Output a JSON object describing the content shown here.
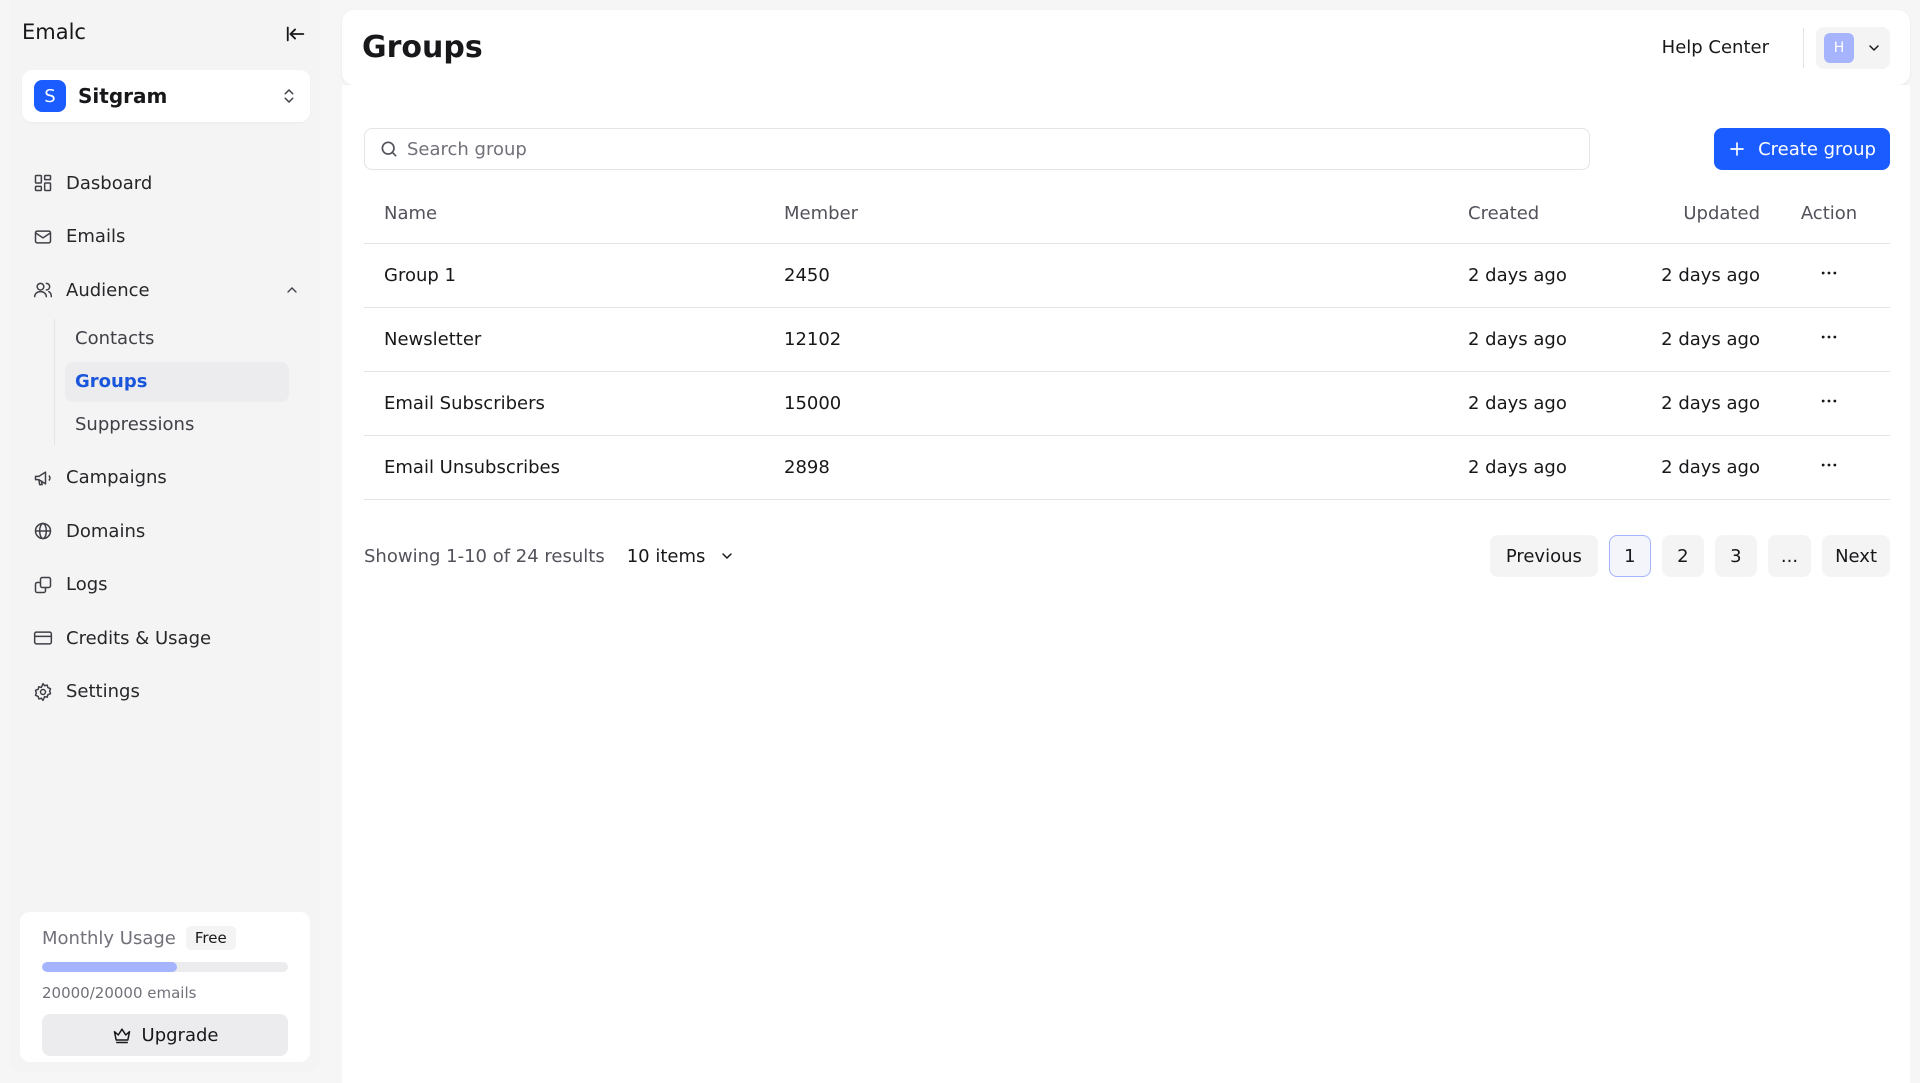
{
  "app": {
    "brand": "Emalc"
  },
  "workspace": {
    "initial": "S",
    "name": "Sitgram"
  },
  "nav": {
    "dashboard": "Dasboard",
    "emails": "Emails",
    "audience": "Audience",
    "audience_sub": [
      "Contacts",
      "Groups",
      "Suppressions"
    ],
    "campaigns": "Campaigns",
    "domains": "Domains",
    "logs": "Logs",
    "credits": "Credits & Usage",
    "settings": "Settings"
  },
  "usage": {
    "title": "Monthly Usage",
    "plan": "Free",
    "count_text": "20000/20000 emails",
    "progress_percent": 55,
    "upgrade_label": "Upgrade"
  },
  "header": {
    "title": "Groups",
    "help_label": "Help Center",
    "user_initial": "H"
  },
  "search": {
    "placeholder": "Search group",
    "value": ""
  },
  "create_label": "Create group",
  "table": {
    "columns": [
      "Name",
      "Member",
      "Created",
      "Updated",
      "Action"
    ],
    "rows": [
      {
        "name": "Group 1",
        "member": "2450",
        "created": "2 days ago",
        "updated": "2 days ago"
      },
      {
        "name": "Newsletter",
        "member": "12102",
        "created": "2 days ago",
        "updated": "2 days ago"
      },
      {
        "name": "Email Subscribers",
        "member": "15000",
        "created": "2 days ago",
        "updated": "2 days ago"
      },
      {
        "name": "Email Unsubscribes",
        "member": "2898",
        "created": "2 days ago",
        "updated": "2 days ago"
      }
    ]
  },
  "pagination": {
    "results_text": "Showing 1-10 of 24 results",
    "page_size": "10 items",
    "previous": "Previous",
    "pages": [
      "1",
      "2",
      "3",
      "..."
    ],
    "next": "Next"
  },
  "colors": {
    "accent": "#1a5cff",
    "active_text": "#1a56db",
    "avatar": "#a5b4fc"
  }
}
